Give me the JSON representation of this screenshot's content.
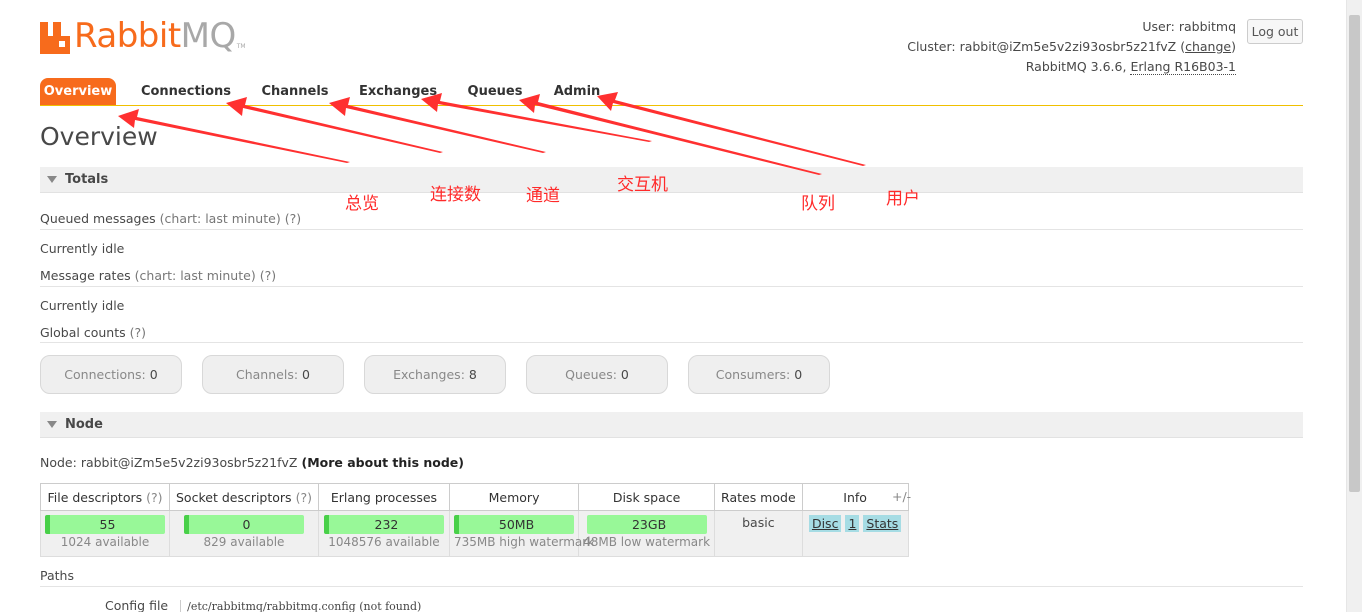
{
  "logo": {
    "rabbit": "Rabbit",
    "mq": "MQ",
    "tm": "TM"
  },
  "header": {
    "user_label": "User:",
    "user": "rabbitmq",
    "cluster_label": "Cluster:",
    "cluster": "rabbit@iZm5e5v2zi93osbr5z21fvZ",
    "change": "change",
    "version": "RabbitMQ 3.6.6,",
    "erlang": "Erlang R16B03-1",
    "logout": "Log out"
  },
  "tabs": [
    {
      "label": "Overview",
      "active": true
    },
    {
      "label": "Connections"
    },
    {
      "label": "Channels"
    },
    {
      "label": "Exchanges"
    },
    {
      "label": "Queues"
    },
    {
      "label": "Admin"
    }
  ],
  "page_title": "Overview",
  "totals": {
    "heading": "Totals",
    "queued_messages": "Queued messages",
    "queued_chart": "(chart: last minute)",
    "help": "(?)",
    "idle1": "Currently idle",
    "message_rates": "Message rates",
    "rates_chart": "(chart: last minute)",
    "idle2": "Currently idle",
    "global_counts": "Global counts",
    "counts": [
      {
        "label": "Connections:",
        "value": "0"
      },
      {
        "label": "Channels:",
        "value": "0"
      },
      {
        "label": "Exchanges:",
        "value": "8"
      },
      {
        "label": "Queues:",
        "value": "0"
      },
      {
        "label": "Consumers:",
        "value": "0"
      }
    ]
  },
  "node": {
    "heading": "Node",
    "node_label": "Node:",
    "node_name": "rabbit@iZm5e5v2zi93osbr5z21fvZ",
    "more": "(More about this node)",
    "columns": [
      "File descriptors",
      "Socket descriptors",
      "Erlang processes",
      "Memory",
      "Disk space",
      "Rates mode",
      "Info"
    ],
    "help": "(?)",
    "file_desc": {
      "value": "55",
      "sub": "1024 available"
    },
    "socket_desc": {
      "value": "0",
      "sub": "829 available"
    },
    "erlang_proc": {
      "value": "232",
      "sub": "1048576 available"
    },
    "memory": {
      "value": "50MB",
      "sub": "735MB high watermark"
    },
    "disk": {
      "value": "23GB",
      "sub": "48MB low watermark"
    },
    "rates_mode": "basic",
    "info": [
      "Disc",
      "1",
      "Stats"
    ],
    "plus_minus": "+/-"
  },
  "paths": {
    "heading": "Paths",
    "config_label": "Config file",
    "config_value": "/etc/rabbitmq/rabbitmq.config (not found)"
  },
  "annotations": {
    "overview": "总览",
    "connections": "连接数",
    "channels": "通道",
    "exchanges": "交互机",
    "queues": "队列",
    "admin": "用户",
    "color": "#ff2a2a"
  }
}
